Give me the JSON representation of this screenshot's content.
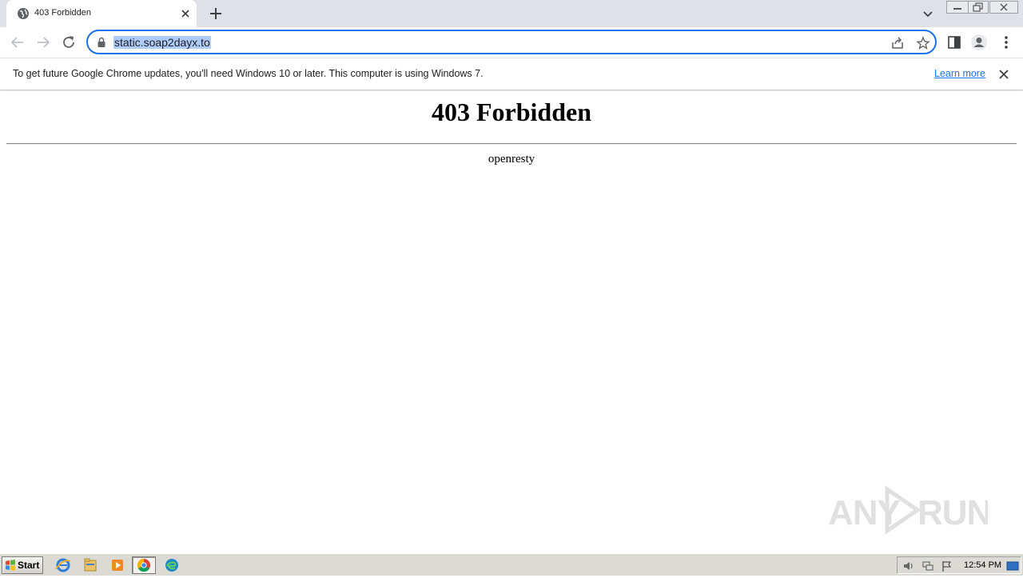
{
  "browser": {
    "tab": {
      "title": "403 Forbidden",
      "favicon": "globe-icon"
    },
    "address_bar": {
      "url": "static.soap2dayx.to"
    },
    "icons": {
      "back": "arrow-left-icon",
      "forward": "arrow-right-icon",
      "reload": "reload-icon",
      "share": "share-icon",
      "bookmark": "star-icon",
      "side_panel": "side-panel-icon",
      "profile": "profile-icon",
      "menu": "kebab-menu-icon"
    },
    "accent_color": "#1a73e8"
  },
  "infobar": {
    "message": "To get future Google Chrome updates, you'll need Windows 10 or later. This computer is using Windows 7.",
    "link": "Learn more"
  },
  "page": {
    "heading": "403 Forbidden",
    "server": "openresty"
  },
  "watermark": {
    "text_left": "ANY",
    "text_right": "RUN"
  },
  "taskbar": {
    "start_label": "Start",
    "apps": [
      "internet-explorer-icon",
      "folder-icon",
      "media-player-icon",
      "chrome-icon",
      "edge-icon"
    ],
    "clock": "12:54 PM"
  }
}
